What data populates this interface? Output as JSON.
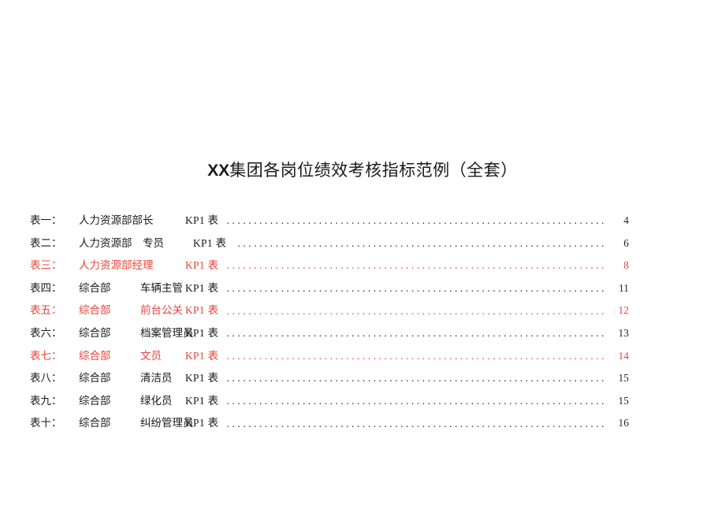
{
  "document": {
    "title_prefix": "XX",
    "title_rest": "集团各岗位绩效考核指标范例（全套）",
    "background_color": "#ffffff",
    "text_color": "#1a1a1a",
    "highlight_color": "#e8453c"
  },
  "toc": {
    "rows": [
      {
        "label": "表一：",
        "dept": "人力资源部部长",
        "position": "",
        "kpi": "KP1 表",
        "page": "4",
        "color": "black",
        "indent": false
      },
      {
        "label": "表二：",
        "dept": "人力资源部　专员",
        "position": "",
        "kpi": "KP1 表",
        "page": "6",
        "color": "black",
        "indent": true
      },
      {
        "label": "表三：",
        "dept": "人力资源部经理",
        "position": "",
        "kpi": "KP1 表",
        "page": "8",
        "color": "red",
        "indent": false
      },
      {
        "label": "表四：",
        "dept": "综合部",
        "position": "车辆主管",
        "kpi": "KP1 表",
        "page": "11",
        "color": "black",
        "indent": false
      },
      {
        "label": "表五：",
        "dept": "综合部",
        "position": "前台公关",
        "kpi": "KP1 表",
        "page": "12",
        "color": "red",
        "indent": false
      },
      {
        "label": "表六：",
        "dept": "综合部",
        "position": "档案管理员",
        "kpi": "KP1 表",
        "page": "13",
        "color": "black",
        "indent": false
      },
      {
        "label": "表七：",
        "dept": "综合部",
        "position": "文员",
        "kpi": "KP1 表",
        "page": "14",
        "color": "red",
        "indent": false
      },
      {
        "label": "表八：",
        "dept": "综合部",
        "position": "清洁员",
        "kpi": "KP1 表",
        "page": "15",
        "color": "black",
        "indent": false
      },
      {
        "label": "表九：",
        "dept": "综合部",
        "position": "绿化员",
        "kpi": "KP1 表",
        "page": "15",
        "color": "black",
        "indent": false
      },
      {
        "label": "表十：",
        "dept": "综合部",
        "position": "纠纷管理员",
        "kpi": "KP1 表",
        "page": "16",
        "color": "black",
        "indent": false
      }
    ]
  }
}
